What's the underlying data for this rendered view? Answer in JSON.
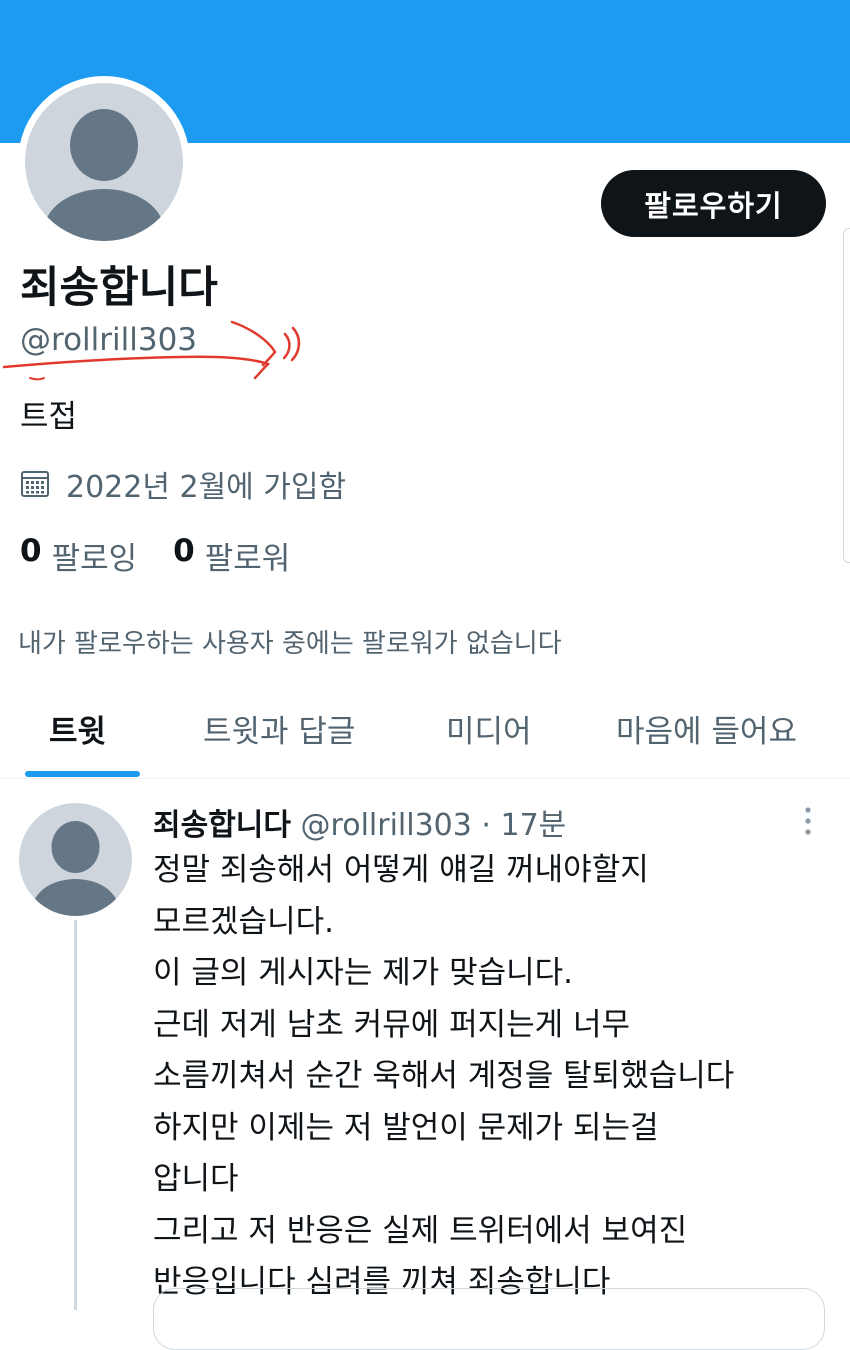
{
  "profile": {
    "display_name": "죄송합니다",
    "handle": "@rollrill303",
    "bio": "트접",
    "joined": "2022년 2월에 가입함",
    "following_count": "0",
    "following_label": "팔로잉",
    "followers_count": "0",
    "followers_label": "팔로워",
    "follow_button": "팔로우하기",
    "followers_you_know": "내가 팔로우하는 사용자 중에는 팔로워가 없습니다"
  },
  "tabs": [
    {
      "label": "트윗",
      "active": true
    },
    {
      "label": "트윗과 답글",
      "active": false
    },
    {
      "label": "미디어",
      "active": false
    },
    {
      "label": "마음에 들어요",
      "active": false
    }
  ],
  "tweet": {
    "author_name": "죄송합니다",
    "author_handle": "@rollrill303",
    "time": "· 17분",
    "lines": [
      "정말 죄송해서 어떻게 얘길 꺼내야할지",
      "모르겠습니다.",
      "이 글의 게시자는 제가 맞습니다.",
      "근데 저게 남초 커뮤에 퍼지는게 너무",
      "소름끼쳐서 순간 욱해서 계정을 탈퇴했습니다",
      "하지만 이제는 저 발언이 문제가 되는걸",
      "압니다",
      "그리고 저 반응은 실제 트위터에서 보여진",
      "반응입니다 심려를 끼쳐 죄송합니다"
    ]
  },
  "colors": {
    "banner": "#1d9bf0",
    "accent": "#1d9bf0",
    "text_primary": "#0f1419",
    "text_secondary": "#536471",
    "annotation": "#e03a2f"
  },
  "icons": {
    "calendar": "calendar-icon",
    "more": "more-vertical-icon",
    "avatar": "default-avatar-icon"
  }
}
